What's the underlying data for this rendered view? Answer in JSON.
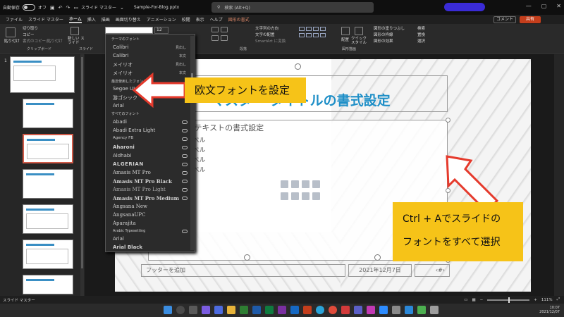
{
  "titlebar": {
    "autosave_label": "自動保存",
    "autosave_state": "オフ",
    "slide_master_label": "スライド マスター",
    "filename": "Sample-For-Blog.pptx",
    "search_placeholder": "検索 (Alt+Q)"
  },
  "tabs": {
    "items": [
      "ファイル",
      "スライド マスター",
      "ホーム",
      "挿入",
      "描画",
      "画面切り替え",
      "アニメーション",
      "校閲",
      "表示",
      "ヘルプ",
      "図形の書式"
    ],
    "active": "ホーム",
    "comment_label": "コメント",
    "share_label": "共有"
  },
  "ribbon": {
    "paste": "貼り付け",
    "cut": "切り取り",
    "copy": "コピー",
    "format_painter": "書式のコピー/貼り付け",
    "clipboard_group": "クリップボード",
    "new_slide": "新しい スライド",
    "slide_group": "スライド",
    "font_size": "12",
    "text_direction": "文字列の方向",
    "align_text": "文字の配置",
    "smartart": "SmartArt に変換",
    "paragraph_group": "段落",
    "arrange": "配置",
    "quick_styles": "クイック スタイル",
    "shape_fill": "図形の塗りつぶし",
    "shape_outline": "図形の枠線",
    "shape_effects": "図形の効果",
    "drawing_group": "図形描画",
    "find": "検索",
    "replace": "置換",
    "select": "選択"
  },
  "font_dropdown": {
    "theme_fonts_header": "テーマのフォント",
    "theme_fonts": [
      {
        "name": "Calibri",
        "tag": "見出し"
      },
      {
        "name": "Calibri",
        "tag": "本文"
      },
      {
        "name": "メイリオ",
        "tag": "見出し"
      },
      {
        "name": "メイリオ",
        "tag": "本文"
      }
    ],
    "recent_header": "最近使用したフォント",
    "recent_fonts": [
      "Segoe UI",
      "游ゴシック",
      "Arial"
    ],
    "all_header": "すべてのフォント",
    "all_fonts": [
      "Abadi",
      "Abadi Extra Light",
      "Agency FB",
      "Aharoni",
      "Aldhabi",
      "ALGERIAN",
      "Amasis MT Pro",
      "Amasis MT Pro Black",
      "Amasis MT Pro Light",
      "Amasis MT Pro Medium",
      "Angsana New",
      "AngsanaUPC",
      "Aparajita",
      "Arabic Typesetting",
      "Arial",
      "Arial Black"
    ]
  },
  "slide": {
    "title": "マスター タイトルの書式設定",
    "body_first": "マスター テキストの書式設定",
    "levels": [
      "第 2 レベル",
      "第 3 レベル",
      "第 4 レベル",
      "第 5 レベル"
    ],
    "footer": "フッターを追加",
    "date": "2021年12月7日",
    "page_marker": "‹#›"
  },
  "thumbnails": {
    "first_number": "1",
    "count_visible": 8
  },
  "callouts": {
    "western_font": "欧文フォントを設定",
    "select_all_line1": "Ctrl + Aでスライドの",
    "select_all_line2": "フォントをすべて選択"
  },
  "statusbar": {
    "mode": "スライド マスター",
    "zoom": "111%"
  },
  "taskbar": {
    "time": "10:07",
    "date": "2021/12/07"
  }
}
